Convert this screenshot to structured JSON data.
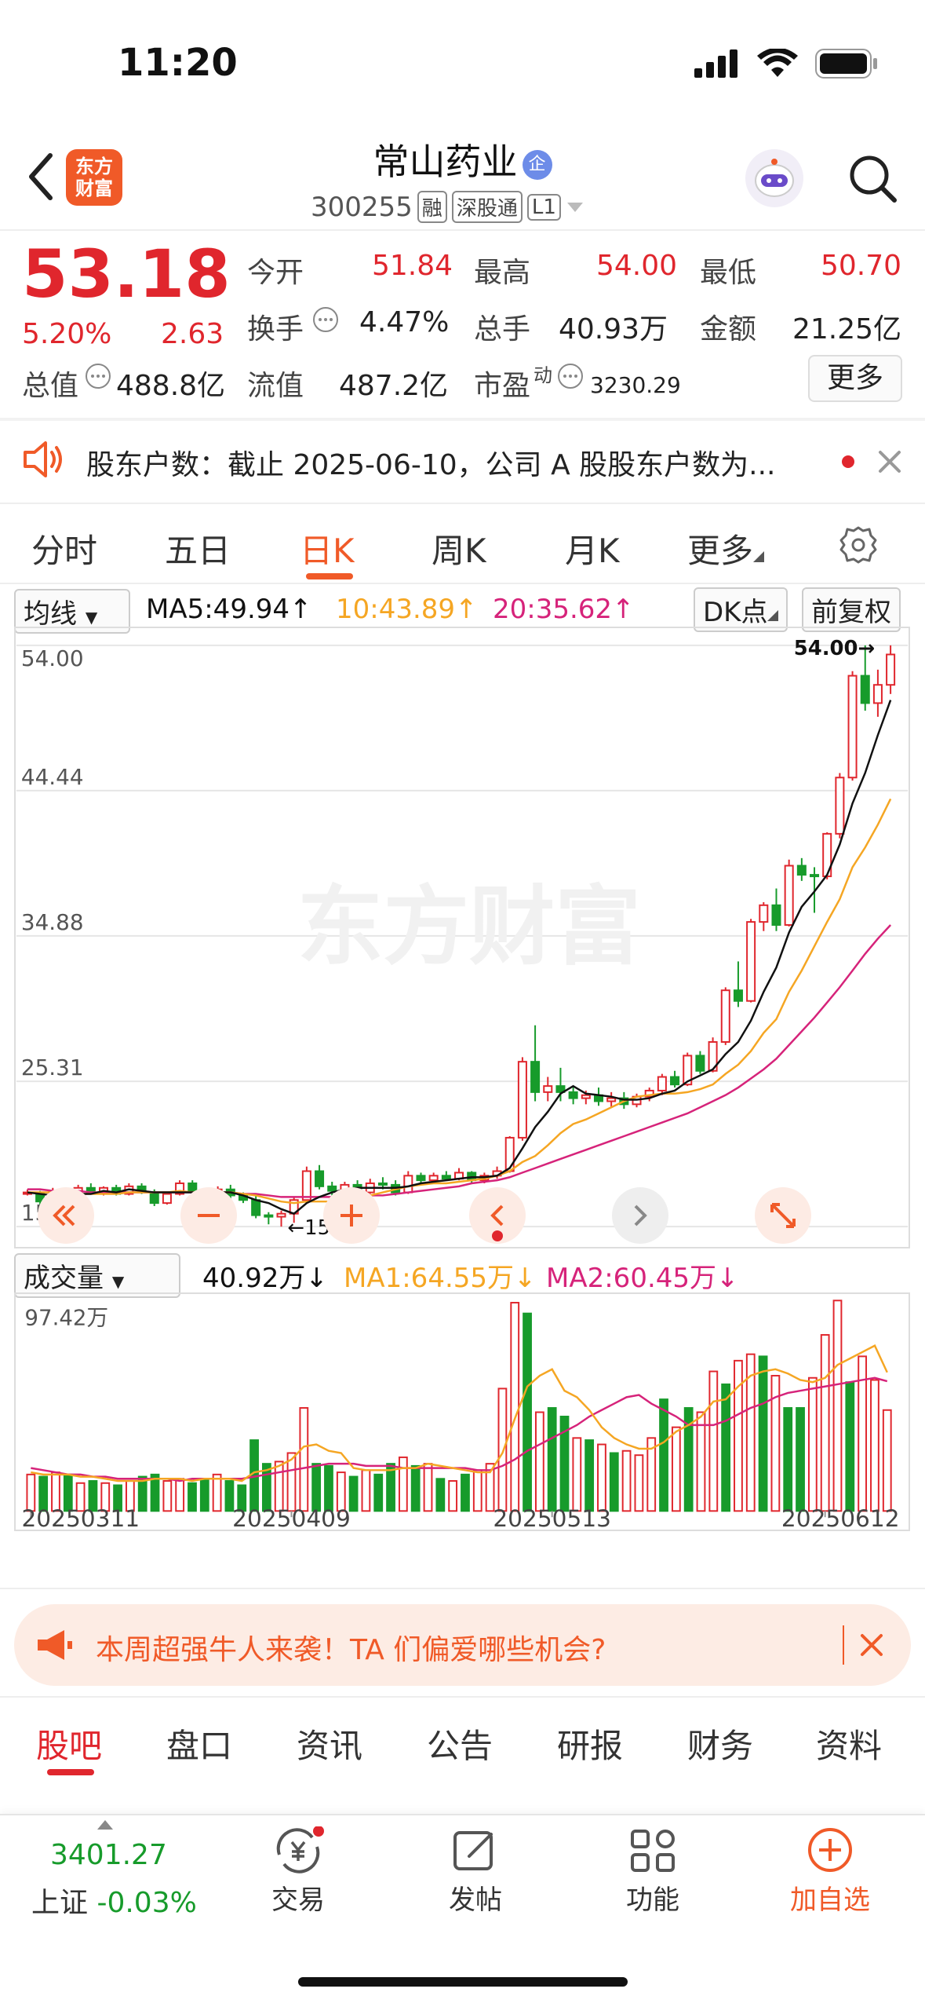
{
  "status_bar": {
    "time": "11:20"
  },
  "header": {
    "logo_line1": "东方",
    "logo_line2": "财富",
    "title": "常山药业",
    "title_badge": "企",
    "code": "300255",
    "tags": [
      "融",
      "深股通",
      "L1"
    ]
  },
  "quote": {
    "price": "53.18",
    "change_pct": "5.20%",
    "change": "2.63",
    "rows": [
      [
        {
          "label": "今开",
          "value": "51.84",
          "color": "red"
        },
        {
          "label": "最高",
          "value": "54.00",
          "color": "red"
        },
        {
          "label": "最低",
          "value": "50.70",
          "color": "red"
        }
      ],
      [
        {
          "label": "换手",
          "value": "4.47%",
          "color": "plain"
        },
        {
          "label": "总手",
          "value": "40.93万",
          "color": "plain"
        },
        {
          "label": "金额",
          "value": "21.25亿",
          "color": "plain"
        }
      ]
    ],
    "market_cap_label": "总值",
    "market_cap": "488.8亿",
    "float_cap_label": "流值",
    "float_cap": "487.2亿",
    "pe_label": "市盈",
    "pe_sup": "动",
    "pe": "3230.29",
    "more_button": "更多"
  },
  "notice": {
    "text": "股东户数：截止 2025-06-10，公司 A 股股东户数为..."
  },
  "period_tabs": [
    {
      "label": "分时",
      "active": false
    },
    {
      "label": "五日",
      "active": false
    },
    {
      "label": "日K",
      "active": true
    },
    {
      "label": "周K",
      "active": false
    },
    {
      "label": "月K",
      "active": false
    },
    {
      "label": "更多",
      "active": false
    }
  ],
  "kline_header": {
    "indicator_select": "均线",
    "ma5": "MA5:49.94",
    "ma10": "10:43.89",
    "ma20": "20:35.62",
    "dk_button": "DK点",
    "adjust_button": "前复权"
  },
  "volume_header": {
    "indicator_select": "成交量",
    "volume": "40.92万",
    "ma1": "MA1:64.55万",
    "ma2": "MA2:60.45万"
  },
  "colors": {
    "up": "#e0262d",
    "down": "#179b2b",
    "ma5": "#111111",
    "ma10": "#f5a623",
    "ma20": "#d6237a",
    "accent": "#f05a28"
  },
  "chart_data": [
    {
      "type": "candlestick",
      "title": "",
      "y_ticks": [
        "54.00",
        "44.44",
        "34.88",
        "25.31",
        "15.75"
      ],
      "ylim": [
        15.75,
        54.0
      ],
      "high_label": "54.00",
      "low_label": "15.75",
      "candles": [
        [
          17.9,
          18.2,
          17.8,
          18.0
        ],
        [
          18.0,
          18.1,
          17.2,
          17.4
        ],
        [
          17.4,
          18.3,
          17.3,
          18.1
        ],
        [
          18.1,
          18.2,
          17.5,
          17.7
        ],
        [
          17.7,
          18.5,
          17.6,
          18.3
        ],
        [
          18.3,
          18.6,
          17.9,
          18.0
        ],
        [
          18.0,
          18.4,
          17.8,
          18.3
        ],
        [
          18.3,
          18.5,
          17.8,
          17.9
        ],
        [
          17.9,
          18.6,
          17.8,
          18.4
        ],
        [
          18.4,
          18.6,
          17.9,
          18.0
        ],
        [
          18.0,
          18.2,
          17.1,
          17.3
        ],
        [
          17.3,
          18.0,
          17.2,
          17.9
        ],
        [
          17.9,
          18.8,
          17.8,
          18.6
        ],
        [
          18.6,
          18.8,
          17.8,
          18.0
        ],
        [
          18.0,
          18.3,
          17.5,
          17.6
        ],
        [
          17.6,
          18.4,
          17.5,
          18.2
        ],
        [
          18.2,
          18.5,
          17.6,
          17.8
        ],
        [
          17.8,
          18.0,
          17.3,
          17.5
        ],
        [
          17.5,
          17.8,
          16.3,
          16.5
        ],
        [
          16.5,
          16.7,
          15.9,
          16.4
        ],
        [
          16.4,
          16.8,
          15.75,
          16.6
        ],
        [
          16.6,
          17.7,
          16.0,
          17.5
        ],
        [
          17.5,
          19.7,
          17.3,
          19.4
        ],
        [
          19.4,
          19.8,
          18.2,
          18.4
        ],
        [
          18.4,
          18.7,
          17.8,
          18.1
        ],
        [
          18.1,
          18.7,
          17.8,
          18.5
        ],
        [
          18.5,
          18.8,
          17.8,
          18.0
        ],
        [
          18.0,
          18.9,
          17.9,
          18.6
        ],
        [
          18.6,
          19.0,
          18.2,
          18.5
        ],
        [
          18.5,
          18.8,
          17.8,
          18.0
        ],
        [
          18.0,
          19.4,
          17.9,
          19.1
        ],
        [
          19.1,
          19.3,
          18.6,
          18.8
        ],
        [
          18.8,
          19.3,
          18.6,
          19.1
        ],
        [
          19.1,
          19.4,
          18.8,
          18.9
        ],
        [
          18.9,
          19.6,
          18.8,
          19.3
        ],
        [
          19.3,
          19.4,
          18.6,
          18.8
        ],
        [
          18.8,
          19.3,
          18.6,
          19.1
        ],
        [
          19.1,
          19.7,
          18.9,
          19.4
        ],
        [
          19.4,
          21.7,
          19.3,
          21.6
        ],
        [
          21.6,
          26.9,
          21.4,
          26.6
        ],
        [
          26.6,
          29.0,
          24.0,
          24.6
        ],
        [
          24.6,
          25.6,
          24.0,
          25.0
        ],
        [
          25.0,
          26.2,
          24.0,
          24.6
        ],
        [
          24.6,
          25.0,
          23.8,
          24.2
        ],
        [
          24.2,
          24.7,
          23.8,
          24.4
        ],
        [
          24.4,
          24.9,
          23.7,
          24.0
        ],
        [
          24.0,
          24.6,
          23.6,
          24.2
        ],
        [
          24.2,
          24.6,
          23.5,
          23.8
        ],
        [
          23.8,
          24.5,
          23.6,
          24.3
        ],
        [
          24.3,
          24.9,
          24.0,
          24.7
        ],
        [
          24.7,
          25.8,
          24.4,
          25.6
        ],
        [
          25.6,
          26.0,
          24.9,
          25.1
        ],
        [
          25.1,
          27.2,
          25.0,
          27.0
        ],
        [
          27.0,
          27.3,
          25.8,
          26.0
        ],
        [
          26.0,
          28.2,
          25.9,
          27.9
        ],
        [
          27.9,
          31.5,
          27.7,
          31.3
        ],
        [
          31.3,
          33.2,
          30.2,
          30.6
        ],
        [
          30.6,
          36.0,
          30.5,
          35.8
        ],
        [
          35.8,
          37.1,
          35.2,
          36.9
        ],
        [
          36.9,
          38.0,
          35.2,
          35.6
        ],
        [
          35.6,
          39.9,
          35.5,
          39.5
        ],
        [
          39.5,
          40.0,
          38.5,
          38.9
        ],
        [
          38.9,
          39.4,
          36.4,
          38.8
        ],
        [
          38.8,
          41.7,
          38.6,
          41.6
        ],
        [
          41.6,
          45.6,
          41.3,
          45.3
        ],
        [
          45.3,
          52.3,
          45.1,
          52.0
        ],
        [
          52.0,
          54.0,
          49.7,
          50.2
        ],
        [
          50.2,
          52.4,
          49.3,
          51.4
        ],
        [
          51.4,
          54.0,
          50.8,
          53.4
        ]
      ],
      "ma5": [
        18.0,
        17.9,
        17.8,
        17.8,
        17.9,
        17.9,
        18.1,
        18.0,
        18.2,
        18.1,
        18.0,
        18.0,
        18.0,
        18.0,
        17.9,
        18.0,
        18.0,
        17.8,
        17.5,
        17.3,
        16.9,
        16.6,
        17.3,
        17.7,
        18.0,
        18.2,
        18.3,
        18.3,
        18.3,
        18.3,
        18.4,
        18.6,
        18.7,
        18.8,
        18.9,
        19.0,
        19.0,
        19.1,
        19.6,
        20.9,
        22.3,
        23.3,
        24.5,
        25.0,
        24.5,
        24.4,
        24.3,
        24.1,
        24.1,
        24.2,
        24.5,
        24.7,
        25.3,
        25.7,
        26.1,
        27.1,
        27.9,
        29.3,
        31.2,
        32.8,
        35.1,
        36.8,
        37.8,
        38.9,
        40.9,
        43.6,
        45.6,
        48.1,
        50.4
      ],
      "ma10": [
        18.0,
        18.0,
        18.0,
        18.0,
        17.9,
        17.9,
        17.9,
        17.9,
        18.0,
        18.0,
        18.0,
        18.0,
        18.1,
        18.0,
        18.0,
        18.0,
        18.0,
        17.9,
        17.8,
        17.6,
        17.4,
        17.3,
        17.4,
        17.4,
        17.4,
        17.5,
        17.6,
        17.8,
        18.0,
        18.2,
        18.4,
        18.5,
        18.6,
        18.6,
        18.7,
        18.8,
        18.9,
        19.1,
        19.4,
        20.0,
        20.4,
        21.1,
        21.9,
        22.5,
        22.8,
        23.2,
        23.6,
        24.0,
        24.3,
        24.4,
        24.5,
        24.5,
        24.6,
        24.8,
        25.1,
        25.8,
        26.4,
        27.3,
        28.5,
        29.4,
        31.2,
        32.6,
        34.2,
        35.8,
        37.3,
        39.4,
        40.7,
        42.2,
        43.9
      ],
      "ma20": [
        18.2,
        18.2,
        18.1,
        18.1,
        18.1,
        18.0,
        18.0,
        18.0,
        18.0,
        18.0,
        18.0,
        18.0,
        18.0,
        18.0,
        18.0,
        18.0,
        18.0,
        17.9,
        17.9,
        17.8,
        17.7,
        17.7,
        17.7,
        17.7,
        17.7,
        17.7,
        17.7,
        17.8,
        17.8,
        17.9,
        18.0,
        18.1,
        18.2,
        18.3,
        18.4,
        18.6,
        18.7,
        18.8,
        19.0,
        19.3,
        19.6,
        19.9,
        20.2,
        20.5,
        20.8,
        21.1,
        21.4,
        21.7,
        22.0,
        22.3,
        22.6,
        22.9,
        23.2,
        23.6,
        24.0,
        24.4,
        24.9,
        25.5,
        26.1,
        26.8,
        27.7,
        28.6,
        29.5,
        30.5,
        31.5,
        32.6,
        33.7,
        34.7,
        35.6
      ]
    },
    {
      "type": "bar",
      "title": "",
      "y_ticks": [
        "97.42万"
      ],
      "ylim": [
        0,
        97.42
      ],
      "x_ticks": [
        "20250311",
        "20250409",
        "20250513",
        "20250612"
      ],
      "x_tick_index": [
        0,
        21,
        42,
        64
      ],
      "volume": [
        17,
        16,
        18,
        17,
        13,
        14,
        13,
        12,
        14,
        16,
        17,
        14,
        15,
        13,
        15,
        17,
        14,
        12,
        33,
        22,
        23,
        27,
        48,
        22,
        21,
        18,
        16,
        19,
        17,
        22,
        25,
        21,
        22,
        15,
        14,
        17,
        19,
        22,
        57,
        97,
        92,
        46,
        48,
        44,
        34,
        33,
        31,
        27,
        28,
        26,
        34,
        52,
        39,
        48,
        46,
        65,
        59,
        70,
        73,
        72,
        63,
        48,
        48,
        62,
        82,
        98,
        60,
        72,
        61,
        47
      ],
      "ma1": [
        18,
        17,
        17,
        17,
        16,
        16,
        15,
        14,
        14,
        14,
        15,
        15,
        15,
        14,
        15,
        15,
        15,
        14,
        18,
        19,
        21,
        24,
        30,
        31,
        28,
        27,
        20,
        19,
        19,
        19,
        20,
        20,
        22,
        21,
        20,
        19,
        18,
        18,
        27,
        43,
        58,
        63,
        66,
        56,
        53,
        47,
        39,
        34,
        31,
        29,
        29,
        32,
        37,
        40,
        44,
        51,
        52,
        58,
        63,
        65,
        66,
        64,
        61,
        60,
        62,
        68,
        71,
        74,
        77,
        64.55
      ],
      "ma2": [
        20,
        19,
        18,
        17,
        17,
        16,
        16,
        15,
        15,
        15,
        15,
        15,
        14,
        15,
        15,
        15,
        15,
        15,
        16,
        17,
        18,
        19,
        20,
        21,
        22,
        22,
        22,
        21,
        21,
        21,
        20,
        20,
        20,
        20,
        20,
        20,
        19,
        19,
        21,
        24,
        28,
        31,
        34,
        37,
        40,
        44,
        47,
        50,
        53,
        54,
        50,
        47,
        44,
        40,
        40,
        40,
        42,
        45,
        48,
        50,
        53,
        55,
        56,
        57,
        58,
        59,
        60,
        61,
        62,
        60.45
      ]
    }
  ],
  "promo": {
    "text": "本周超强牛人来袭！TA 们偏爱哪些机会?"
  },
  "bottom_tabs": [
    {
      "label": "股吧",
      "active": true
    },
    {
      "label": "盘口",
      "active": false
    },
    {
      "label": "资讯",
      "active": false
    },
    {
      "label": "公告",
      "active": false
    },
    {
      "label": "研报",
      "active": false
    },
    {
      "label": "财务",
      "active": false
    },
    {
      "label": "资料",
      "active": false
    }
  ],
  "bottom_nav": {
    "index_value": "3401.27",
    "index_name": "上证",
    "index_change": "-0.03%",
    "items": [
      "交易",
      "发帖",
      "功能",
      "加自选"
    ]
  }
}
